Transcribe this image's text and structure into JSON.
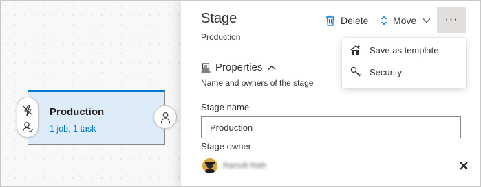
{
  "stage_card": {
    "title": "Production",
    "summary": "1 job, 1 task"
  },
  "panel": {
    "title": "Stage",
    "subtitle": "Production",
    "toolbar": {
      "delete_label": "Delete",
      "move_label": "Move",
      "more_label": "···"
    },
    "properties": {
      "heading": "Properties",
      "description": "Name and owners of the stage"
    },
    "stage_name": {
      "label": "Stage name",
      "value": "Production"
    },
    "stage_owner": {
      "label": "Stage owner",
      "name": "Ramulli Rath"
    }
  },
  "menu": {
    "items": [
      {
        "label": "Save as template",
        "icon": "save-template-icon"
      },
      {
        "label": "Security",
        "icon": "key-icon"
      }
    ]
  },
  "colors": {
    "accent": "#0078d4",
    "card_background": "#deecf9",
    "more_button_bg": "#e1dfdd"
  }
}
